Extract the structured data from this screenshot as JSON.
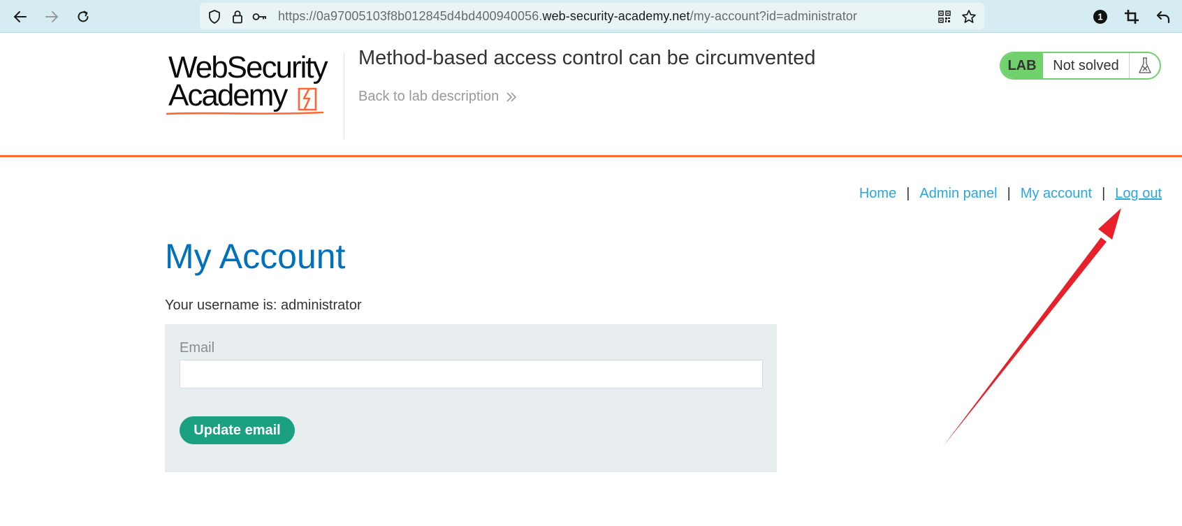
{
  "browser": {
    "url_prefix": "https://0a97005103f8b012845d4bd400940056.",
    "url_host": "web-security-academy.net",
    "url_path": "/my-account?id=administrator",
    "extension_badge": "1"
  },
  "header": {
    "logo_line1": "WebSecurity",
    "logo_line2": "Academy",
    "lab_title": "Method-based access control can be circumvented",
    "back_link": "Back to lab description",
    "lab_badge_label": "LAB",
    "lab_status": "Not solved"
  },
  "nav": {
    "home": "Home",
    "admin_panel": "Admin panel",
    "my_account": "My account",
    "log_out": "Log out",
    "separator": "|"
  },
  "main": {
    "title": "My Account",
    "username_line": "Your username is: administrator",
    "email_label": "Email",
    "email_value": "",
    "update_button": "Update email"
  },
  "colors": {
    "accent_orange": "#ff6633",
    "link_blue": "#29a8e0",
    "title_blue": "#0071bc",
    "lab_green": "#70d16d",
    "button_green": "#1ba181",
    "annotation_red": "#e8202a"
  }
}
